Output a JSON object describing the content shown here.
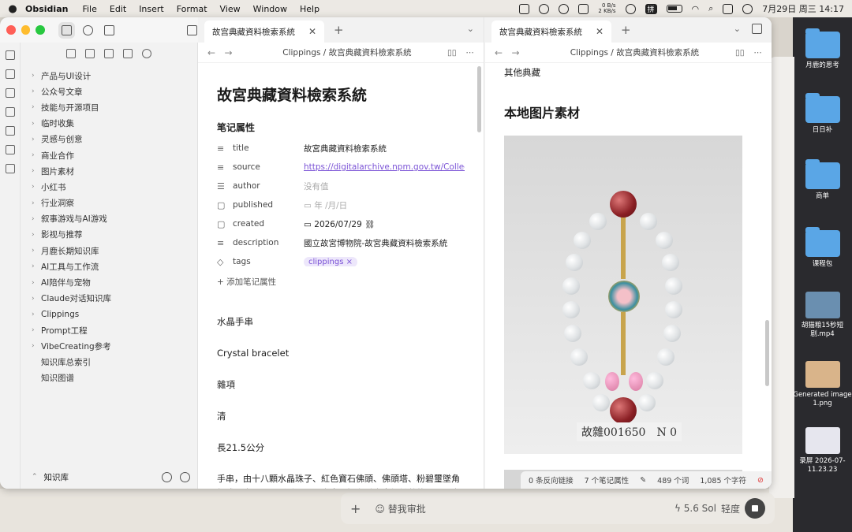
{
  "menubar": {
    "app_name": "Obsidian",
    "menus": [
      "File",
      "Edit",
      "Insert",
      "Format",
      "View",
      "Window",
      "Help"
    ],
    "net_up": "0 B/s",
    "net_down": "2 KB/s",
    "ime": "拼",
    "datetime": "7月29日 周三 14:17"
  },
  "sidebar": {
    "items": [
      {
        "label": "产品与UI设计",
        "folder": true
      },
      {
        "label": "公众号文章",
        "folder": true
      },
      {
        "label": "技能与开源项目",
        "folder": true
      },
      {
        "label": "临时收集",
        "folder": true
      },
      {
        "label": "灵感与创意",
        "folder": true
      },
      {
        "label": "商业合作",
        "folder": true
      },
      {
        "label": "图片素材",
        "folder": true
      },
      {
        "label": "小红书",
        "folder": true
      },
      {
        "label": "行业洞察",
        "folder": true
      },
      {
        "label": "叙事游戏与AI游戏",
        "folder": true
      },
      {
        "label": "影视与推荐",
        "folder": true
      },
      {
        "label": "月鹿长期知识库",
        "folder": true
      },
      {
        "label": "AI工具与工作流",
        "folder": true
      },
      {
        "label": "AI陪伴与宠物",
        "folder": true
      },
      {
        "label": "Claude对话知识库",
        "folder": true
      },
      {
        "label": "Clippings",
        "folder": true
      },
      {
        "label": "Prompt工程",
        "folder": true
      },
      {
        "label": "VibeCreating参考",
        "folder": true
      },
      {
        "label": "知识库总索引",
        "folder": false
      },
      {
        "label": "知识图谱",
        "folder": false
      }
    ],
    "vault_name": "知识库"
  },
  "left_pane": {
    "tab_title": "故宫典藏資料檢索系統",
    "breadcrumb": "Clippings / 故宫典藏資料檢索系統",
    "note_title": "故宮典藏資料檢索系統",
    "props_heading": "笔记属性",
    "properties": [
      {
        "icon": "text-icon",
        "glyph": "≡",
        "key": "title",
        "value": "故宮典藏資料檢索系統",
        "style": ""
      },
      {
        "icon": "text-icon",
        "glyph": "≡",
        "key": "source",
        "value": "https://digitalarchive.npm.gov.tw/Collec",
        "style": "link"
      },
      {
        "icon": "list-icon",
        "glyph": "☰",
        "key": "author",
        "value": "没有值",
        "style": "muted"
      },
      {
        "icon": "calendar-icon",
        "glyph": "▢",
        "key": "published",
        "value": "▭  年 /月/日",
        "style": "muted"
      },
      {
        "icon": "calendar-icon",
        "glyph": "▢",
        "key": "created",
        "value": "▭  2026/07/29 ⛓",
        "style": ""
      },
      {
        "icon": "text-icon",
        "glyph": "≡",
        "key": "description",
        "value": "國立故宮博物院-故宮典藏資料檢索系統",
        "style": ""
      }
    ],
    "tags_key": "tags",
    "tag_value": "clippings ×",
    "add_property": "+  添加笔记属性",
    "paragraphs": [
      "水晶手串",
      "Crystal bracelet",
      "雜項",
      "清",
      "長21.5公分"
    ],
    "long_paragraph": "手串，由十八顆水晶珠子、紅色寶石佛頭、佛頭塔、粉碧璽墜角組成。十八子又稱手串，原本應是握在手中念經計數的工具，十八世紀中期以來，已成為祈福裝飾之用，也"
  },
  "right_pane": {
    "tab_title": "故宫典藏資料檢索系統",
    "breadcrumb": "Clippings / 故宫典藏資料檢索系統",
    "top_text": "其他典藏",
    "heading": "本地图片素材",
    "museum_number": "故雜001650　N 0",
    "status": {
      "backlinks": "0 条反向链接",
      "props": "7 个笔记属性",
      "words": "489 个词",
      "chars": "1,085 个字符"
    }
  },
  "bottom_bar": {
    "review_label": "替我审批",
    "model_label": "5.6 Sol",
    "effort_label": "轻度"
  },
  "desktop": {
    "items": [
      "月鹿的思考",
      "日日补",
      "商单",
      "课程包",
      "胡猫粮15秒短剧.mp4",
      "Generated image 1.png",
      "录屏 2026-07-11.23.23"
    ]
  }
}
